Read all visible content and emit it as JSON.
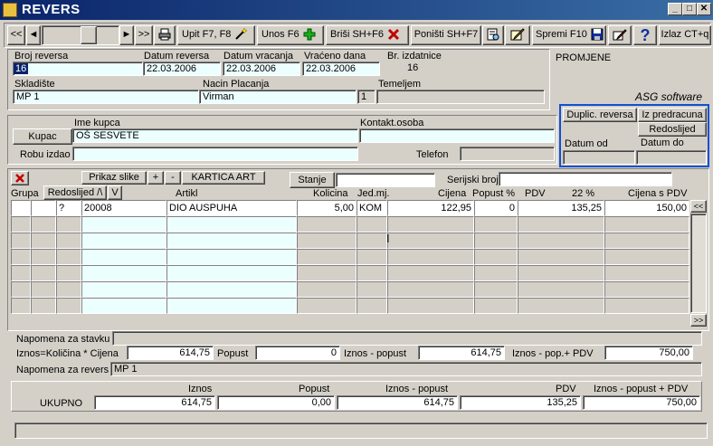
{
  "window": {
    "title": "REVERS"
  },
  "toolbar": {
    "first": "<<",
    "prev": "◄",
    "next": "►",
    "last": ">>",
    "upit": "Upit F7, F8",
    "unos": "Unos F6",
    "brisi": "Briši  SH+F6",
    "ponisti": "Poništi SH+F7",
    "spremi": "Spremi F10",
    "izlaz": "Izlaz CT+q"
  },
  "header": {
    "broj_reversa_label": "Broj reversa",
    "broj_reversa": "16",
    "datum_reversa_label": "Datum reversa",
    "datum_reversa": "22.03.2006",
    "datum_vracanja_label": "Datum vracanja",
    "datum_vracanja": "22.03.2006",
    "vraceno_dana_label": "Vraćeno dana",
    "vraceno_dana": "22.03.2006",
    "br_izdatnice_label": "Br. izdatnice",
    "br_izdatnice": "16",
    "skladiste_label": "Skladište",
    "skladiste": "MP 1",
    "nacin_placanja_label": "Nacin Placanja",
    "nacin_placanja": "Virman",
    "nacin_code": "1",
    "temeljem_label": "Temeljem",
    "temeljem": "",
    "promjene_label": "PROMJENE",
    "asg": "ASG software"
  },
  "kupac": {
    "ime_label": "Ime kupca",
    "button": "Kupac",
    "ime": "OŠ SESVETE",
    "kontakt_label": "Kontakt.osoba",
    "kontakt": "",
    "robu_label": "Robu izdao",
    "robu": "",
    "telefon_label": "Telefon",
    "telefon": ""
  },
  "side": {
    "duplic": "Duplic. reversa",
    "iz_predracuna": "Iz predracuna",
    "redoslijed": "Redoslijed",
    "datum_od": "Datum od",
    "datum_do": "Datum do"
  },
  "items": {
    "prikaz_slike": "Prikaz slike",
    "plus": "+",
    "minus": "-",
    "kartica": "KARTICA ART",
    "stanje": "Stanje",
    "serijski_label": "Serijski broj",
    "col_grupa": "Grupa",
    "col_redoslijed": "Redoslijed /\\",
    "col_v": "V",
    "col_artikl": "Artikl",
    "col_kolicina": "Kolicina",
    "col_jedmj": "Jed.mj.",
    "col_cijena": "Cijena",
    "col_popust": "Popust %",
    "col_pdv": "PDV",
    "col_pdv_pct": "22 %",
    "col_cijena_pdv": "Cijena s PDV",
    "rows": [
      {
        "grupa": "",
        "red": "",
        "v": "?",
        "sifra": "20008",
        "naziv": "DIO AUSPUHA",
        "kolicina": "5,00",
        "jedmj": "KOM",
        "cijena": "122,95",
        "popust": "0",
        "pdv": "135,25",
        "cijena_pdv": "150,00"
      }
    ],
    "scroll_top": "<<",
    "scroll_bottom": ">>"
  },
  "footer": {
    "napomena_stavka_label": "Napomena za stavku",
    "napomena_stavka": "",
    "iznos_label": "Iznos=Količina * Cijena",
    "iznos": "614,75",
    "popust_label": "Popust",
    "popust": "0",
    "iznos_popust_label": "Iznos - popust",
    "iznos_popust": "614,75",
    "iznos_pdv_label": "Iznos - pop.+ PDV",
    "iznos_pdv": "750,00",
    "napomena_revers_label": "Napomena za revers",
    "napomena_revers": "MP 1"
  },
  "totals": {
    "ukupno_label": "UKUPNO",
    "iznos_label": "Iznos",
    "iznos": "614,75",
    "popust_label": "Popust",
    "popust": "0,00",
    "ip_label": "Iznos - popust",
    "ip": "614,75",
    "pdv_label": "PDV",
    "pdv": "135,25",
    "ipp_label": "Iznos - popust + PDV",
    "ipp": "750,00"
  }
}
